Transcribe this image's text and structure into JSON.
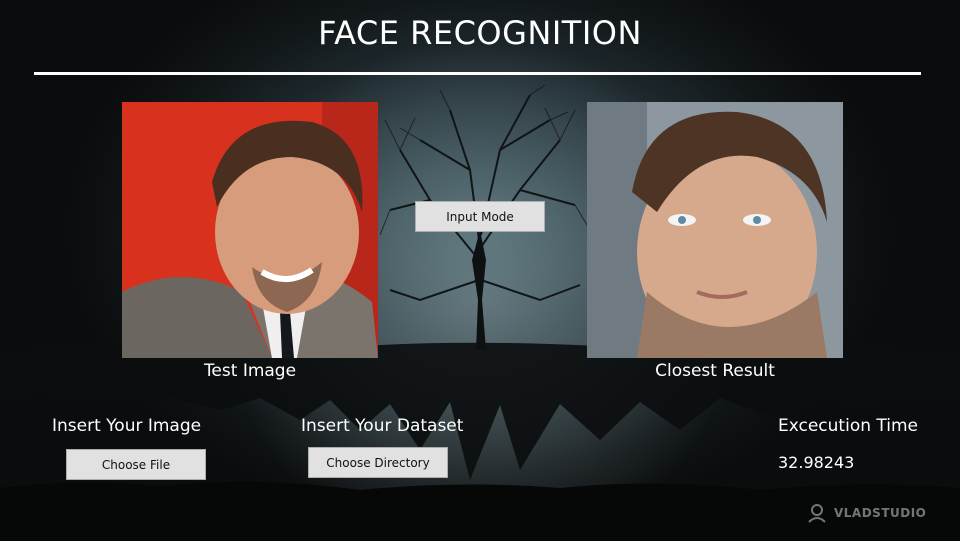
{
  "app": {
    "title": "FACE RECOGNITION"
  },
  "images": {
    "test_caption": "Test Image",
    "result_caption": "Closest Result"
  },
  "controls": {
    "input_mode_label": "Input Mode",
    "insert_image_label": "Insert Your Image",
    "choose_file_label": "Choose File",
    "insert_dataset_label": "Insert Your Dataset",
    "choose_directory_label": "Choose Directory"
  },
  "execution": {
    "label": "Excecution Time",
    "value": "32.98243"
  },
  "branding": {
    "logo_text": "VLADSTUDIO"
  },
  "colors": {
    "accent": "#ffffff",
    "button_bg": "#e1e1e1"
  }
}
